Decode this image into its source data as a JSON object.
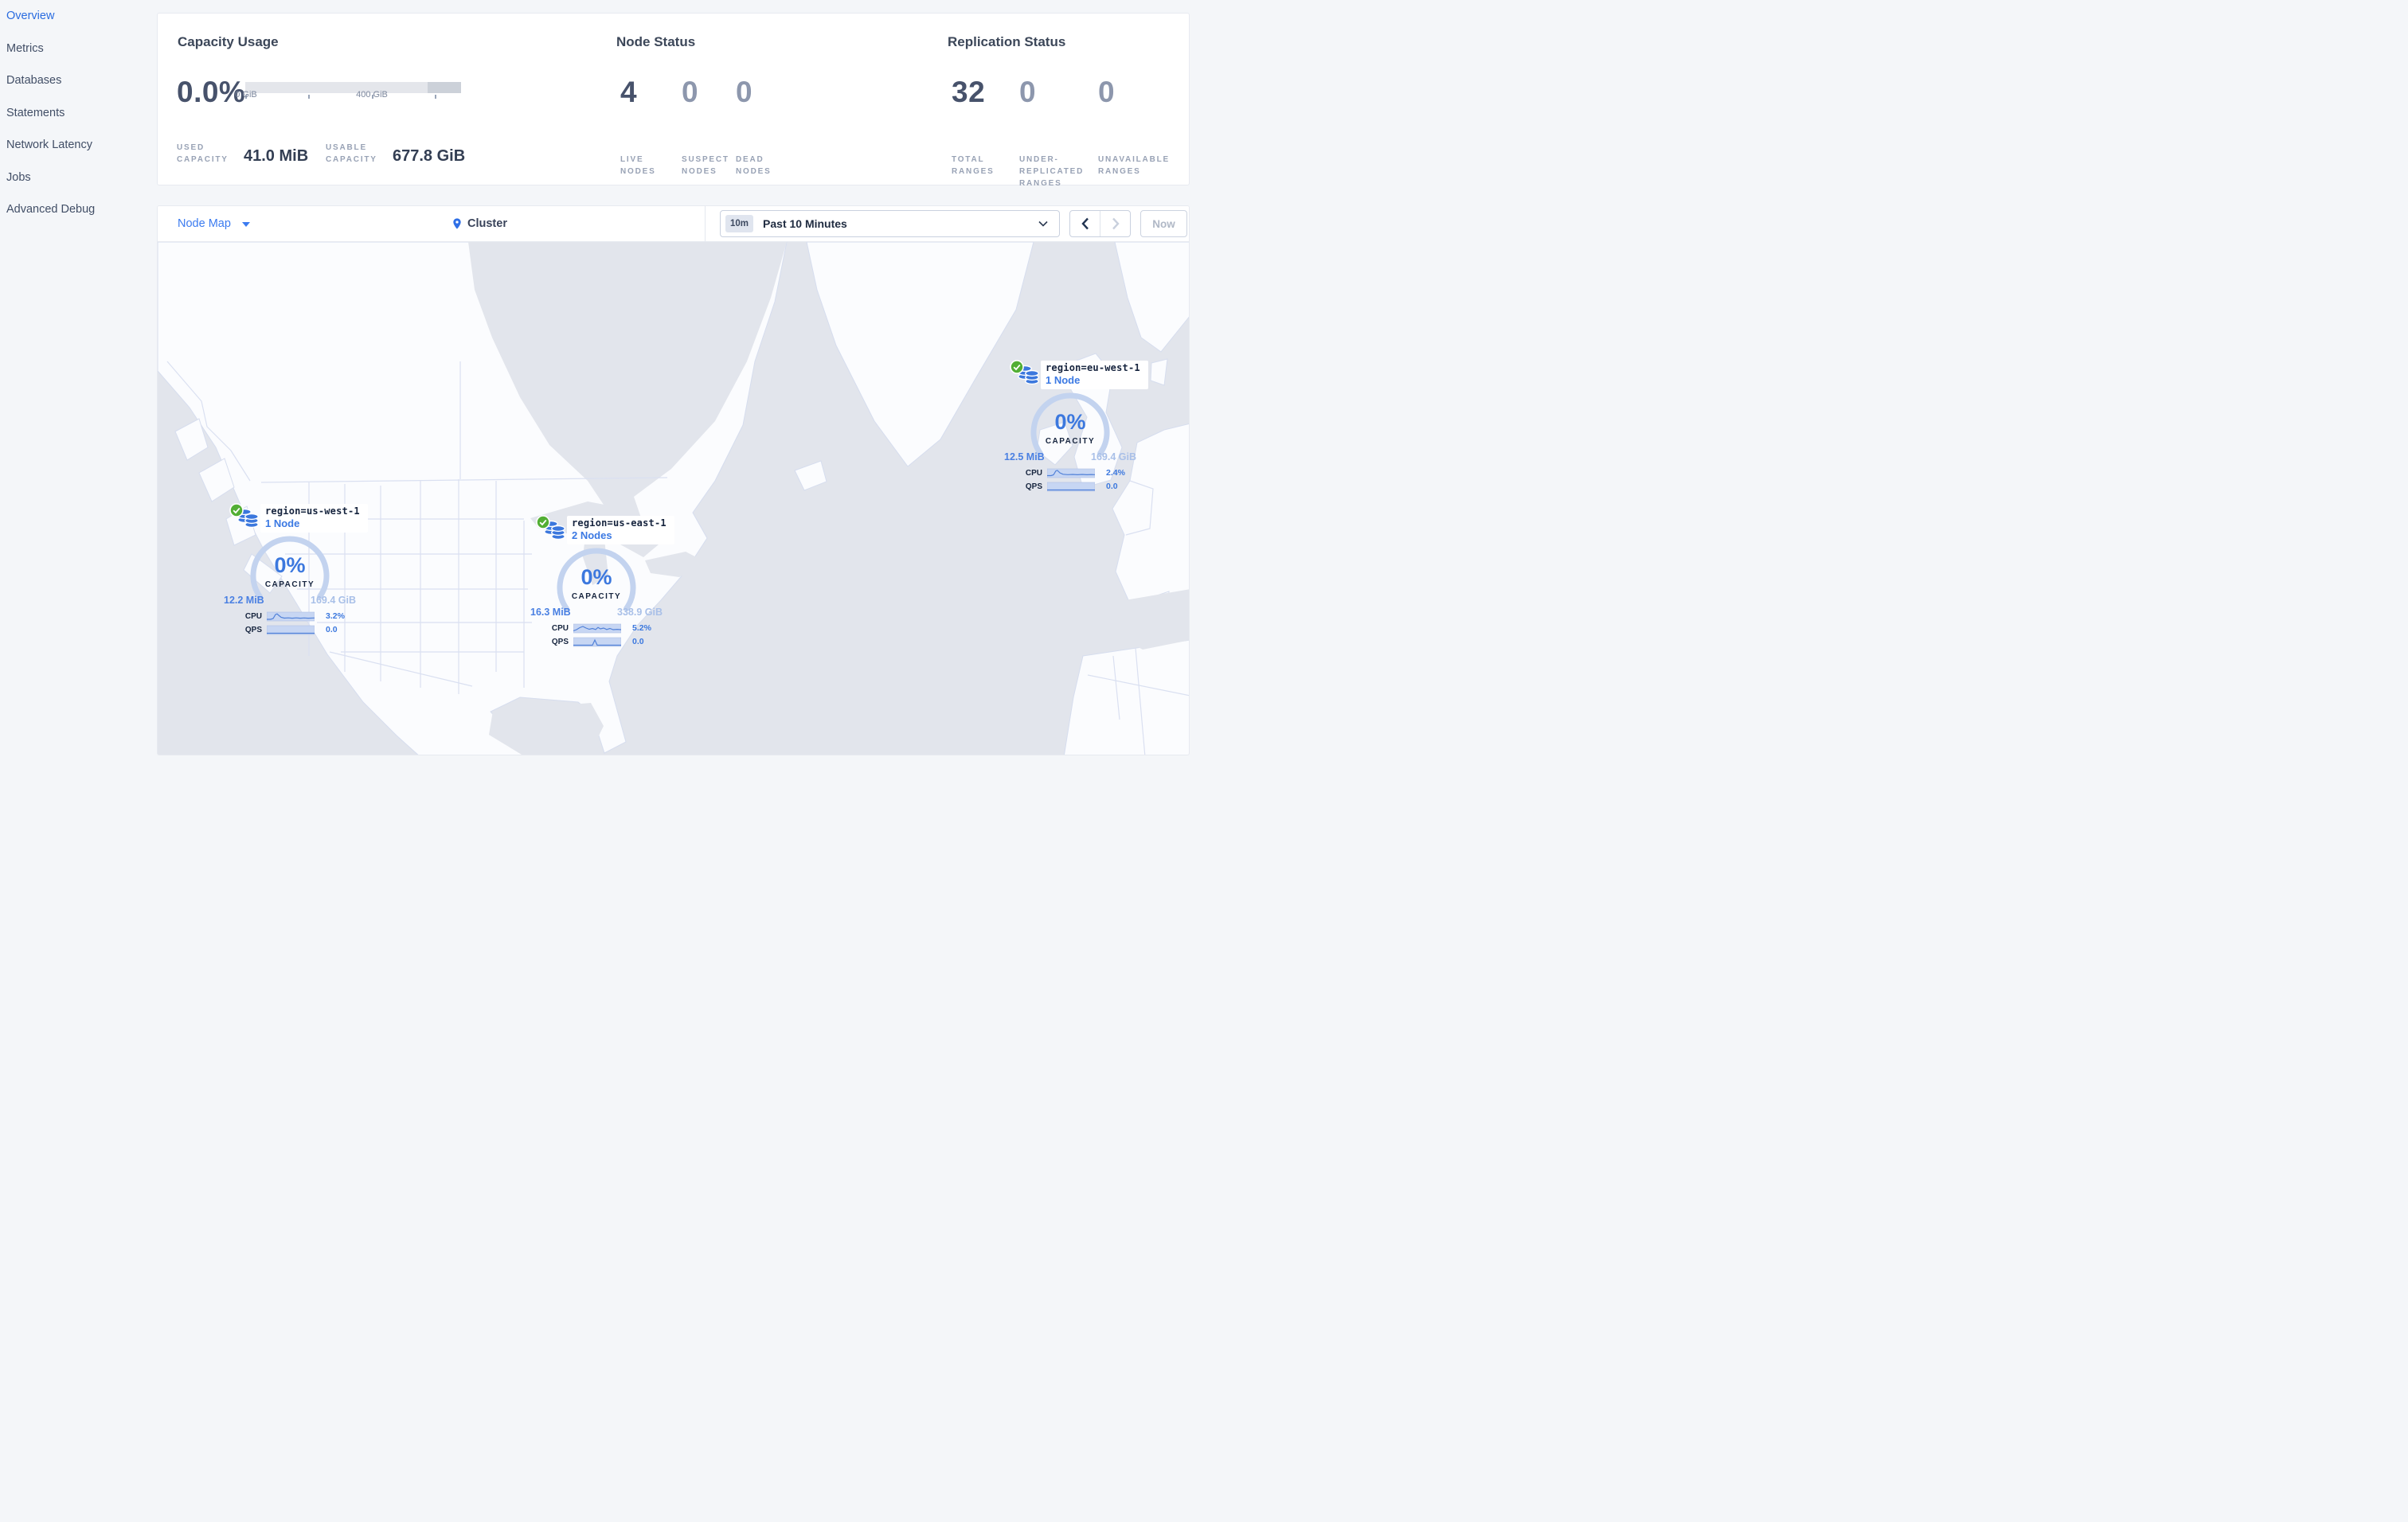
{
  "sidebar": {
    "items": [
      {
        "label": "Overview",
        "active": true
      },
      {
        "label": "Metrics",
        "active": false
      },
      {
        "label": "Databases",
        "active": false
      },
      {
        "label": "Statements",
        "active": false
      },
      {
        "label": "Network Latency",
        "active": false
      },
      {
        "label": "Jobs",
        "active": false
      },
      {
        "label": "Advanced Debug",
        "active": false
      }
    ]
  },
  "summary": {
    "capacity": {
      "title": "Capacity Usage",
      "percent": "0.0%",
      "tick_labels": [
        "0 GiB",
        "400 GiB"
      ],
      "stats": [
        {
          "label": "USED CAPACITY",
          "value": "41.0 MiB"
        },
        {
          "label": "USABLE CAPACITY",
          "value": "677.8 GiB"
        }
      ]
    },
    "node_status": {
      "title": "Node Status",
      "stats": [
        {
          "value": "4",
          "label": "LIVE NODES"
        },
        {
          "value": "0",
          "label": "SUSPECT NODES"
        },
        {
          "value": "0",
          "label": "DEAD NODES"
        }
      ]
    },
    "replication": {
      "title": "Replication Status",
      "stats": [
        {
          "value": "32",
          "label": "TOTAL RANGES"
        },
        {
          "value": "0",
          "label": "UNDER-REPLICATED RANGES"
        },
        {
          "value": "0",
          "label": "UNAVAILABLE RANGES"
        }
      ]
    }
  },
  "toolbar": {
    "view_label": "Node Map",
    "breadcrumb": "Cluster",
    "time_badge": "10m",
    "time_range": "Past 10 Minutes",
    "now_label": "Now"
  },
  "regions": [
    {
      "name": "region=us-west-1",
      "nodes": "1 Node",
      "percent": "0%",
      "capacity_label": "CAPACITY",
      "used": "12.2 MiB",
      "usable": "169.4 GiB",
      "cpu_label": "CPU",
      "cpu_value": "3.2%",
      "qps_label": "QPS",
      "qps_value": "0.0"
    },
    {
      "name": "region=us-east-1",
      "nodes": "2 Nodes",
      "percent": "0%",
      "capacity_label": "CAPACITY",
      "used": "16.3 MiB",
      "usable": "338.9 GiB",
      "cpu_label": "CPU",
      "cpu_value": "5.2%",
      "qps_label": "QPS",
      "qps_value": "0.0"
    },
    {
      "name": "region=eu-west-1",
      "nodes": "1 Node",
      "percent": "0%",
      "capacity_label": "CAPACITY",
      "used": "12.5 MiB",
      "usable": "169.4 GiB",
      "cpu_label": "CPU",
      "cpu_value": "2.4%",
      "qps_label": "QPS",
      "qps_value": "0.0"
    }
  ],
  "colors": {
    "accent_blue": "#3a7be0",
    "link_blue": "#2f6fe6",
    "dark_text": "#394455",
    "muted_label": "#98a2b5",
    "ocean": "#e2e5ec",
    "land": "#fbfcfe",
    "arc_blue": "#c3d3ef",
    "green_ok": "#52ae34"
  }
}
